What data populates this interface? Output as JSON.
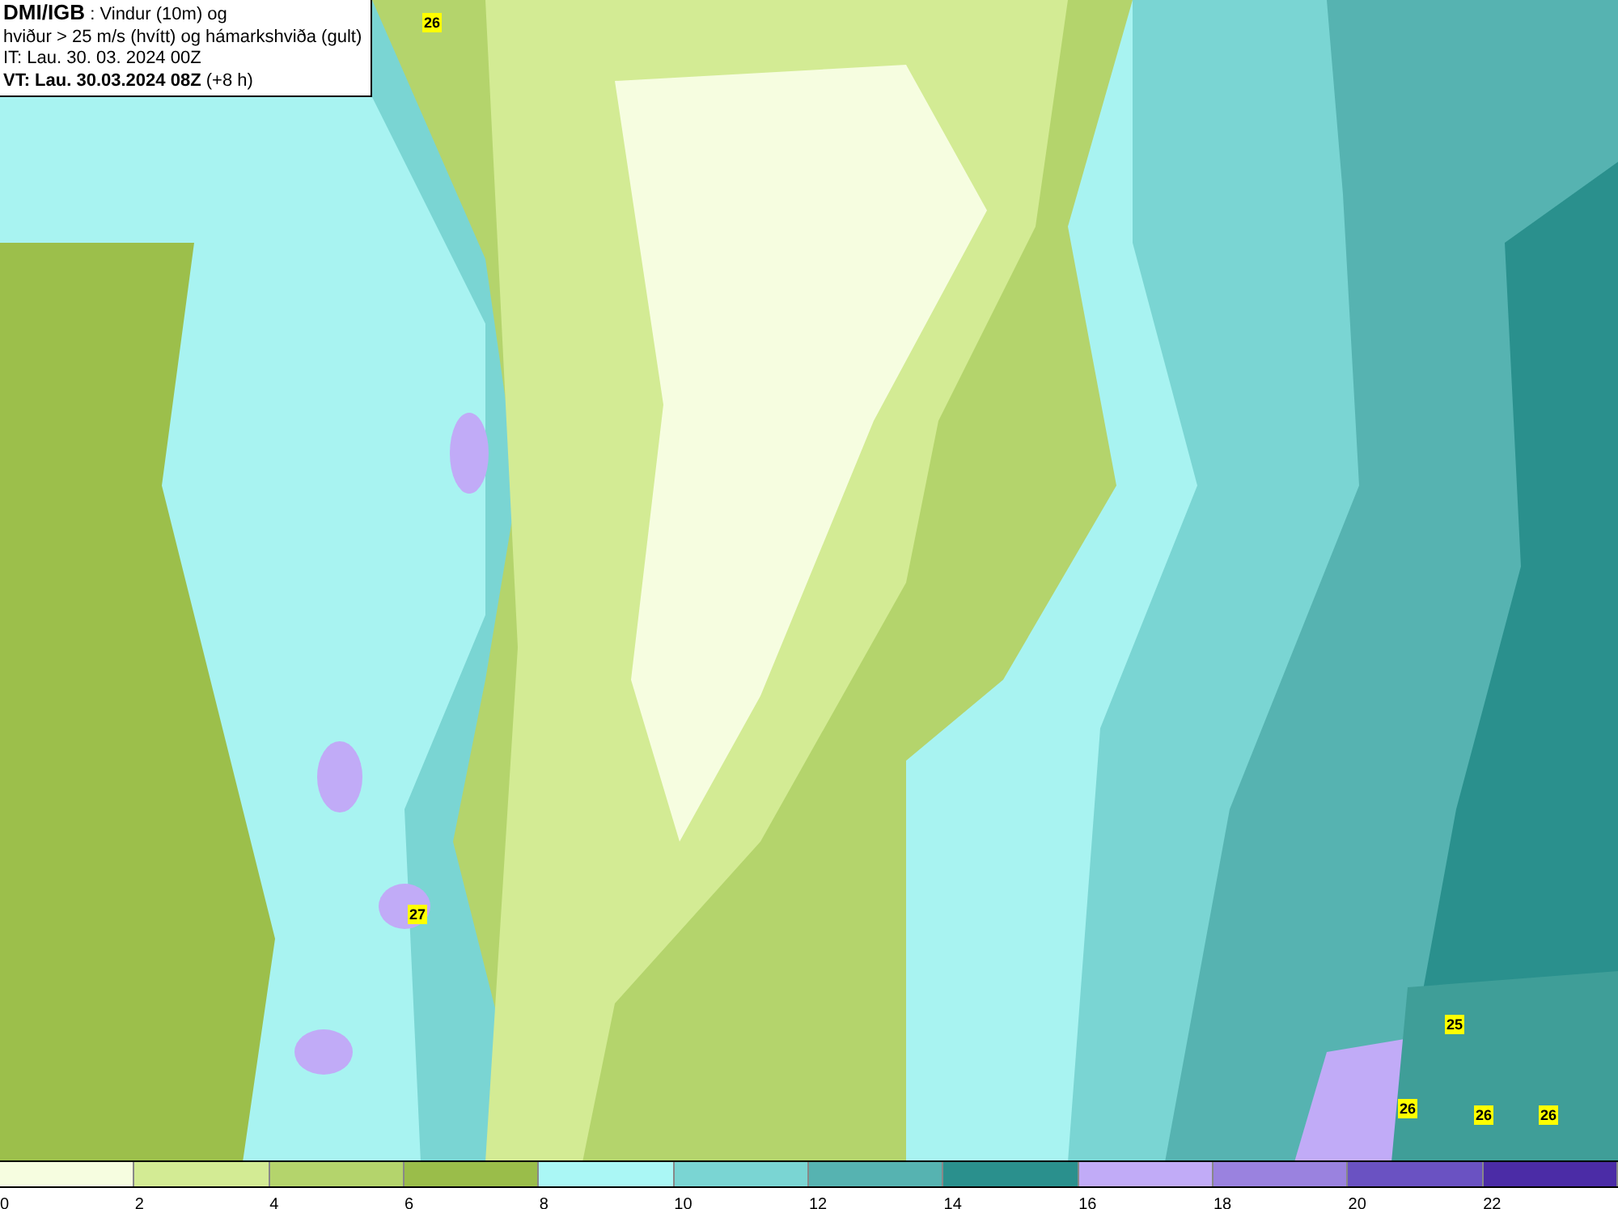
{
  "header": {
    "source": "DMI/IGB",
    "title_rest": " : Vindur (10m) og",
    "line_2": "hviður > 25 m/s (hvítt) og hámarkshviða (gult)",
    "issue_time": "IT: Lau. 30. 03. 2024 00Z",
    "valid_time": "VT: Lau. 30.03.2024 08Z",
    "lead": " (+8 h)"
  },
  "gust_labels": [
    "26",
    "27",
    "25",
    "26",
    "26",
    "26"
  ],
  "colorbar": [
    {
      "label": "0",
      "color": "#f6fde0"
    },
    {
      "label": "2",
      "color": "#d3eb94"
    },
    {
      "label": "4",
      "color": "#b4d46c"
    },
    {
      "label": "6",
      "color": "#9abd4a"
    },
    {
      "label": "8",
      "color": "#aaf7f5"
    },
    {
      "label": "10",
      "color": "#7ad5d3"
    },
    {
      "label": "12",
      "color": "#56b3b1"
    },
    {
      "label": "14",
      "color": "#2a908d"
    },
    {
      "label": "16",
      "color": "#c1abf7"
    },
    {
      "label": "18",
      "color": "#9a82df"
    },
    {
      "label": "20",
      "color": "#6a52c2"
    },
    {
      "label": "22",
      "color": "#4b2ca6"
    }
  ]
}
